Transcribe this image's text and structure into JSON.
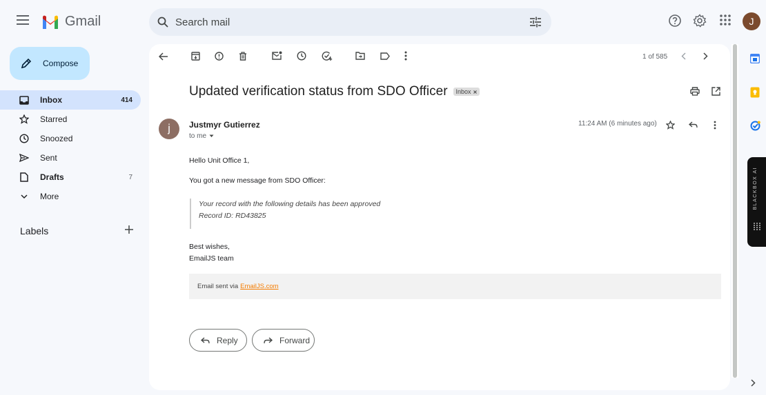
{
  "app": {
    "name": "Gmail",
    "avatar_initial": "J"
  },
  "search": {
    "placeholder": "Search mail"
  },
  "sidebar": {
    "compose_label": "Compose",
    "items": [
      {
        "label": "Inbox",
        "count": "414",
        "active": true,
        "icon": "inbox-icon"
      },
      {
        "label": "Starred",
        "count": "",
        "icon": "star-icon"
      },
      {
        "label": "Snoozed",
        "count": "",
        "icon": "clock-icon"
      },
      {
        "label": "Sent",
        "count": "",
        "icon": "send-icon"
      },
      {
        "label": "Drafts",
        "count": "7",
        "icon": "draft-icon"
      },
      {
        "label": "More",
        "count": "",
        "icon": "chevron-down-icon"
      }
    ],
    "labels_title": "Labels"
  },
  "toolbar": {
    "pager": "1 of 585"
  },
  "email": {
    "subject": "Updated verification status from SDO Officer",
    "label_chip": "Inbox",
    "sender_initial": "j",
    "sender_name": "Justmyr Gutierrez",
    "to": "to me",
    "time": "11:24 AM (6 minutes ago)",
    "greeting": "Hello Unit Office 1,",
    "intro": "You got a new message from SDO Officer:",
    "quote_line1": "Your record with the following details has been approved",
    "quote_line2": "Record ID: RD43825",
    "signoff1": "Best wishes,",
    "signoff2": "EmailJS team",
    "footer_prefix": "Email sent via",
    "footer_link": "EmailJS.com"
  },
  "actions": {
    "reply": "Reply",
    "forward": "Forward"
  },
  "side_panel": {
    "blackbox_label": "BLACKBOX AI"
  },
  "colors": {
    "compose_bg": "#c2e7ff",
    "active_nav_bg": "#d3e3fd",
    "search_bg": "#e9eef6",
    "link": "#f57c00"
  }
}
